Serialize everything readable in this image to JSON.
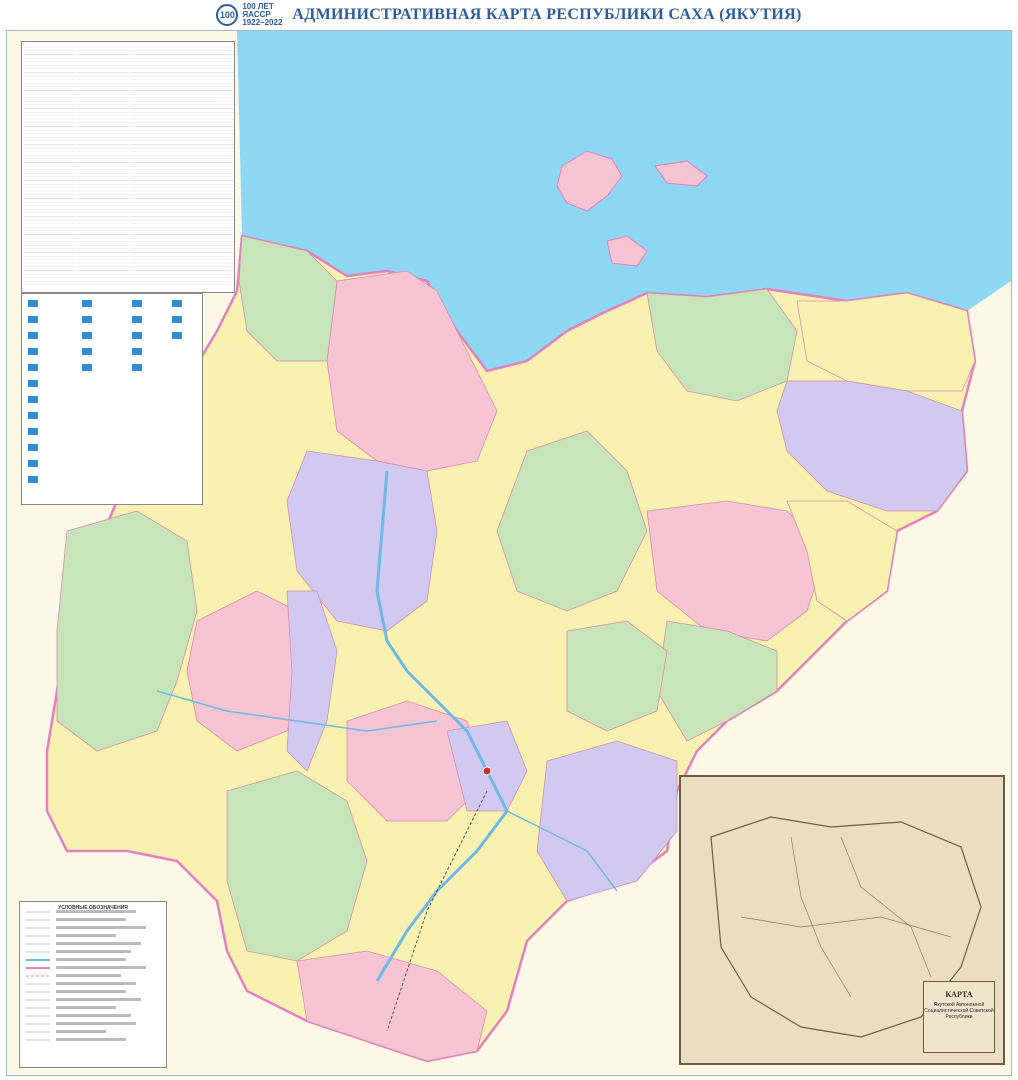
{
  "header": {
    "logo_number": "100",
    "logo_line1": "100 ЛЕТ",
    "logo_line2": "ЯАССР",
    "logo_line3": "1922–2022",
    "title": "АДМИНИСТРАТИВНАЯ КАРТА РЕСПУБЛИКИ САХА (ЯКУТИЯ)"
  },
  "legend": {
    "title": "УСЛОВНЫЕ ОБОЗНАЧЕНИЯ"
  },
  "inset": {
    "card_title": "КАРТА",
    "card_subtitle": "Якутской Автономной Социалистической Советской Республики"
  },
  "colors": {
    "sea": "#8fd8f3",
    "land_outside": "#fdf7e6",
    "region_pink": "#f6c4d3",
    "region_yellow": "#f9f1b0",
    "region_green": "#c6e6b9",
    "region_violet": "#d2c9f0",
    "border_outer": "#e57fbf",
    "title_blue": "#2a5d99"
  }
}
